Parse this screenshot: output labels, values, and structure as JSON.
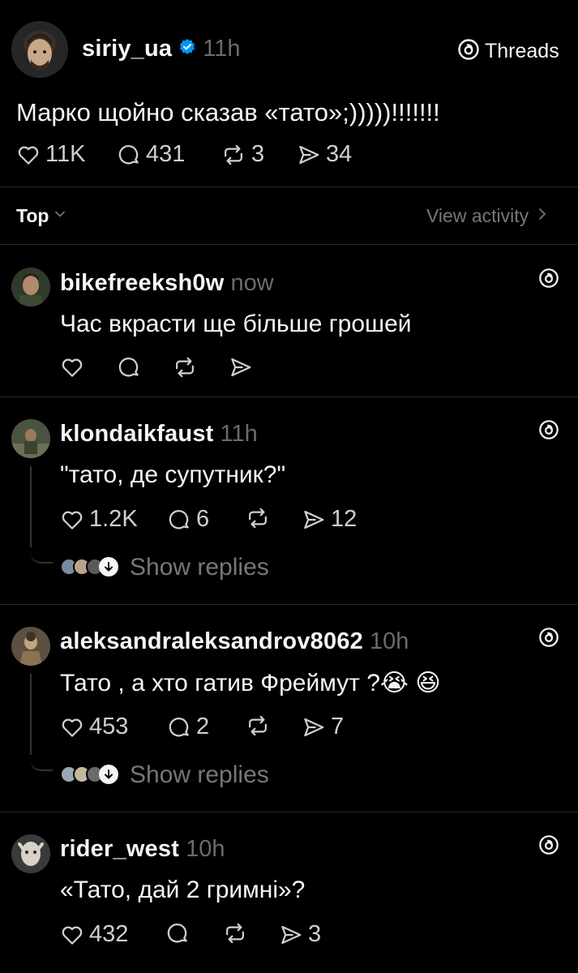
{
  "post": {
    "username": "siriy_ua",
    "time": "11h",
    "brand": "Threads",
    "text": "Марко щойно сказав «тато»;)))))!!!!!!!",
    "likes": "11K",
    "comments": "431",
    "reposts": "3",
    "shares": "34"
  },
  "filter": {
    "sort_label": "Top",
    "view_activity": "View activity"
  },
  "comments": [
    {
      "username": "bikefreeksh0w",
      "time": "now",
      "text": "Час вкрасти ще більше грошей",
      "likes": "",
      "replies": "",
      "reposts": "",
      "shares": ""
    },
    {
      "username": "klondaikfaust",
      "time": "11h",
      "text": "\"тато, де супутник?\"",
      "likes": "1.2K",
      "replies": "6",
      "reposts": "",
      "shares": "12",
      "show_replies": "Show replies"
    },
    {
      "username": "aleksandraleksandrov8062",
      "time": "10h",
      "text": "Тато , а хто гатив Фреймут ?😭 😆",
      "likes": "453",
      "replies": "2",
      "reposts": "",
      "shares": "7",
      "show_replies": "Show replies"
    },
    {
      "username": "rider_west",
      "time": "10h",
      "text": "«Тато, дай 2 гримні»?",
      "likes": "432",
      "replies": "",
      "reposts": "",
      "shares": "3"
    }
  ],
  "colors": {
    "background": "#000000",
    "text": "#f3f5f7",
    "muted": "#77777a",
    "verified": "#0095f6",
    "divider": "#2a2a2a"
  }
}
